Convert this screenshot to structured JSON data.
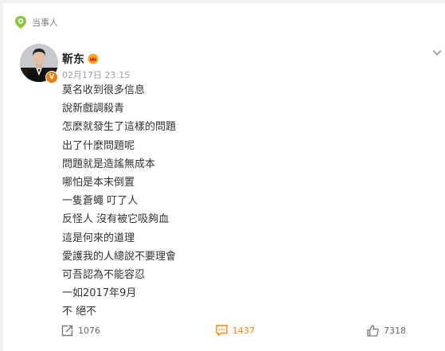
{
  "topic": {
    "label": "当事人",
    "icon": "topic-badge-icon",
    "color": "#8cc63f"
  },
  "post": {
    "username": "靳东",
    "user_badge_icon": "vip-crown-icon",
    "verified_icon": "verified-v-icon",
    "verified_letter": "V",
    "timestamp": "02月17日 23:15",
    "lines": [
      "莫名收到很多信息",
      "說新戲調殺青",
      "怎麼就發生了這樣的問題",
      "出了什麼問題呢",
      "問題就是造謠無成本",
      "哪怕是本末倒置",
      "一隻蒼蠅 叮了人",
      "反怪人 沒有被它吸夠血",
      "這是何來的道理",
      "愛護我的人總說不要理會",
      "可吾認為不能容忍",
      "一如2017年9月",
      "不 絕不"
    ]
  },
  "actions": {
    "repost": {
      "icon": "repost-icon",
      "count": "1076"
    },
    "comment": {
      "icon": "comment-icon",
      "count": "1437",
      "color": "#ff8200"
    },
    "like": {
      "icon": "thumbs-up-icon",
      "count": "7318"
    }
  }
}
